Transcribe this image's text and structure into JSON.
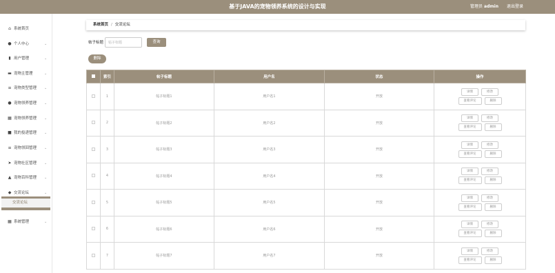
{
  "header": {
    "title": "基于JAVA的宠物领养系统的设计与实现",
    "user_role": "管理员",
    "username": "admin",
    "logout": "退出登录"
  },
  "sidebar": {
    "items": [
      {
        "label": "系统首页",
        "icon": "home-icon",
        "glyph": "⌂"
      },
      {
        "label": "个人中心",
        "icon": "person-icon",
        "glyph": "●"
      },
      {
        "label": "用户管理",
        "icon": "bar-chart-icon",
        "glyph": "▮"
      },
      {
        "label": "宠物主管理",
        "icon": "briefcase-icon",
        "glyph": "▬"
      },
      {
        "label": "宠物类型管理",
        "icon": "list-icon",
        "glyph": "≡"
      },
      {
        "label": "宠物领养管理",
        "icon": "cloud-icon",
        "glyph": "●"
      },
      {
        "label": "宠物领养管理",
        "icon": "grid-icon",
        "glyph": "▦"
      },
      {
        "label": "我的投递管理",
        "icon": "message-icon",
        "glyph": "■"
      },
      {
        "label": "宠物领回管理",
        "icon": "menu-icon",
        "glyph": "≡"
      },
      {
        "label": "宠物社区管理",
        "icon": "send-icon",
        "glyph": "➤"
      },
      {
        "label": "宠物百科管理",
        "icon": "thumbs-up-icon",
        "glyph": "▲"
      },
      {
        "label": "交流论坛",
        "icon": "forum-icon",
        "glyph": "◆"
      },
      {
        "label": "系统管理",
        "icon": "table-icon",
        "glyph": "▦"
      }
    ],
    "sub_item": "交流论坛"
  },
  "breadcrumb": {
    "home": "系统首页",
    "separator": "/",
    "current": "交流论坛"
  },
  "search": {
    "label": "帖子标题",
    "placeholder": "帖子标题",
    "button": "查询"
  },
  "actions": {
    "delete": "删除"
  },
  "table": {
    "columns": [
      "索引",
      "帖子标题",
      "用户名",
      "状态",
      "操作"
    ],
    "rows": [
      {
        "index": "1",
        "title": "帖子标题1",
        "username": "用户名1",
        "status": "开放"
      },
      {
        "index": "2",
        "title": "帖子标题2",
        "username": "用户名2",
        "status": "开放"
      },
      {
        "index": "3",
        "title": "帖子标题3",
        "username": "用户名3",
        "status": "开放"
      },
      {
        "index": "4",
        "title": "帖子标题4",
        "username": "用户名4",
        "status": "开放"
      },
      {
        "index": "5",
        "title": "帖子标题5",
        "username": "用户名5",
        "status": "开放"
      },
      {
        "index": "6",
        "title": "帖子标题6",
        "username": "用户名6",
        "status": "开放"
      },
      {
        "index": "7",
        "title": "帖子标题7",
        "username": "用户名7",
        "status": "开放"
      }
    ],
    "row_buttons": {
      "detail": "详情",
      "edit": "修改",
      "comments": "查看评论",
      "delete": "删除"
    }
  },
  "colors": {
    "accent": "#9b8f7c",
    "sub_text": "#8a7f6c"
  }
}
